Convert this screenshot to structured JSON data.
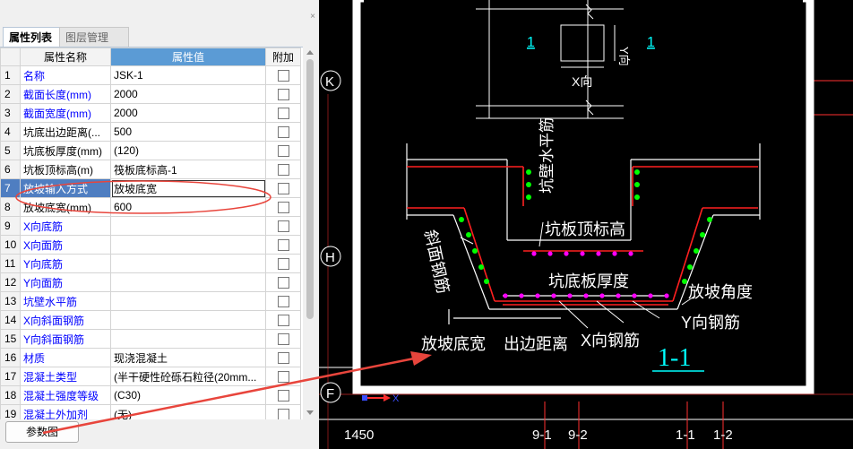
{
  "panel": {
    "tabs": [
      "属性列表",
      "图层管理"
    ],
    "columns": [
      "属性名称",
      "属性值",
      "附加"
    ],
    "rows": [
      {
        "no": "1",
        "name": "名称",
        "value": "JSK-1",
        "blue": true
      },
      {
        "no": "2",
        "name": "截面长度(mm)",
        "value": "2000",
        "blue": true
      },
      {
        "no": "3",
        "name": "截面宽度(mm)",
        "value": "2000",
        "blue": true
      },
      {
        "no": "4",
        "name": "坑底出边距离(...",
        "value": "500",
        "blue": false
      },
      {
        "no": "5",
        "name": "坑底板厚度(mm)",
        "value": "(120)",
        "blue": false
      },
      {
        "no": "6",
        "name": "坑板顶标高(m)",
        "value": "筏板底标高-1",
        "blue": false
      },
      {
        "no": "7",
        "name": "放坡输入方式",
        "value": "放坡底宽",
        "blue": false
      },
      {
        "no": "8",
        "name": "放坡底宽(mm)",
        "value": "600",
        "blue": false
      },
      {
        "no": "9",
        "name": "X向底筋",
        "value": "",
        "blue": true
      },
      {
        "no": "10",
        "name": "X向面筋",
        "value": "",
        "blue": true
      },
      {
        "no": "11",
        "name": "Y向底筋",
        "value": "",
        "blue": true
      },
      {
        "no": "12",
        "name": "Y向面筋",
        "value": "",
        "blue": true
      },
      {
        "no": "13",
        "name": "坑壁水平筋",
        "value": "",
        "blue": true
      },
      {
        "no": "14",
        "name": "X向斜面钢筋",
        "value": "",
        "blue": true
      },
      {
        "no": "15",
        "name": "Y向斜面钢筋",
        "value": "",
        "blue": true
      },
      {
        "no": "16",
        "name": "材质",
        "value": "现浇混凝土",
        "blue": true
      },
      {
        "no": "17",
        "name": "混凝土类型",
        "value": "(半干硬性砼砾石粒径(20mm...",
        "blue": true
      },
      {
        "no": "18",
        "name": "混凝土强度等级",
        "value": "(C30)",
        "blue": true
      },
      {
        "no": "19",
        "name": "混凝土外加剂",
        "value": "(无)",
        "blue": true
      }
    ],
    "selected_row": 7,
    "param_button": "参数图",
    "close_glyph": "×"
  },
  "cad": {
    "axes_left": [
      "K",
      "H",
      "F"
    ],
    "bottom_labels": [
      "1450",
      "9-1",
      "9-2",
      "1-1",
      "1-2"
    ],
    "plan": {
      "marks": [
        "1",
        "1"
      ],
      "x_label": "X向",
      "y_label": "Y向"
    },
    "section": {
      "wall_rebar": "坑壁水平筋",
      "top_elev": "坑板顶标高",
      "slope_rebar": "斜面钢筋",
      "bottom_thick": "坑底板厚度",
      "slope_angle": "放坡角度",
      "y_rebar": "Y向钢筋",
      "x_rebar": "X向钢筋",
      "slope_width": "放坡底宽",
      "edge_dist": "出边距离",
      "title": "1-1"
    },
    "ucs_x": "X",
    "colors": {
      "bg": "#000000",
      "line": "#ffffff",
      "rebar": "#ff0000",
      "dot_green": "#00ff00",
      "dot_mag": "#ff00ff",
      "cyan": "#00ffff",
      "axis_red": "#ff3030"
    }
  }
}
